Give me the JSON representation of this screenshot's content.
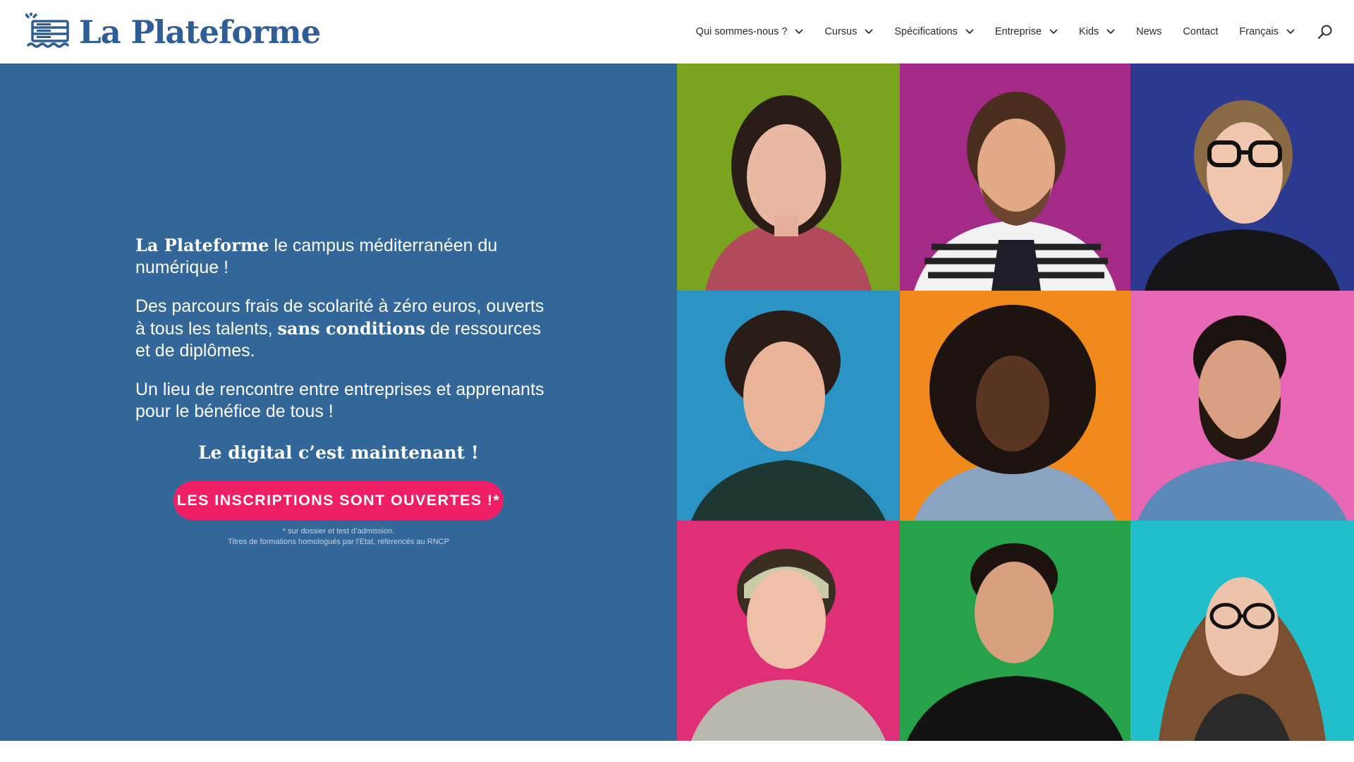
{
  "brand": {
    "name": "La Plateforme",
    "color": "#2f5e96",
    "logo_icon": "server-boat-icon"
  },
  "nav": {
    "items": [
      {
        "label": "Qui sommes-nous ?",
        "dropdown": true
      },
      {
        "label": "Cursus",
        "dropdown": true
      },
      {
        "label": "Spécifications",
        "dropdown": true
      },
      {
        "label": "Entreprise",
        "dropdown": true
      },
      {
        "label": "Kids",
        "dropdown": true
      },
      {
        "label": "News",
        "dropdown": false
      },
      {
        "label": "Contact",
        "dropdown": false
      },
      {
        "label": "Français",
        "dropdown": true
      }
    ],
    "search_icon": "search-icon"
  },
  "hero": {
    "background": "#336699",
    "intro_brand": "La Plateforme",
    "intro_rest": " le campus méditerranéen du numérique !",
    "p2_a": "Des parcours frais de scolarité à zéro euros, ouverts à tous les talents, ",
    "p2_bold": "sans conditions",
    "p2_b": " de ressources et de diplômes.",
    "p3": "Un lieu de rencontre entre entreprises et apprenants pour le bénéfice de tous !",
    "tagline": "Le digital c’est maintenant !",
    "cta_label": "LES INSCRIPTIONS SONT OUVERTES !*",
    "cta_color": "#ee1f64",
    "fine_1": "* sur dossier et test d’admission.",
    "fine_2": "Titres de formations homologués par l’Etat, référencés au RNCP"
  },
  "portraits": [
    {
      "background": "#7aa31f",
      "icon": "portrait-photo"
    },
    {
      "background": "#a32a86",
      "icon": "portrait-photo"
    },
    {
      "background": "#2b3a8f",
      "icon": "portrait-photo"
    },
    {
      "background": "#2a93c4",
      "icon": "portrait-photo"
    },
    {
      "background": "#f08a1c",
      "icon": "portrait-photo"
    },
    {
      "background": "#e768b4",
      "icon": "portrait-photo"
    },
    {
      "background": "#df2f76",
      "icon": "portrait-photo"
    },
    {
      "background": "#25a24a",
      "icon": "portrait-photo"
    },
    {
      "background": "#21bfcc",
      "icon": "portrait-photo"
    }
  ]
}
